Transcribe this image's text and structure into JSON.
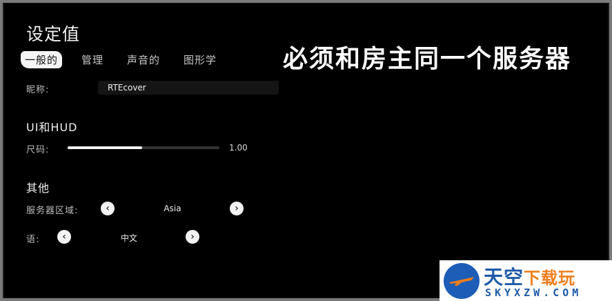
{
  "title": "设定值",
  "tabs": [
    {
      "label": "一般的",
      "active": true
    },
    {
      "label": "管理",
      "active": false
    },
    {
      "label": "声音的",
      "active": false
    },
    {
      "label": "图形学",
      "active": false
    }
  ],
  "general": {
    "nickname_label": "昵称:",
    "nickname_value": "RTEcover"
  },
  "ui_hud": {
    "section_title": "UI和HUD",
    "size_label": "尺码:",
    "size_value": "1.00",
    "size_fraction": 0.49
  },
  "other": {
    "section_title": "其他",
    "server_region_label": "服务器区域:",
    "server_region_value": "Asia",
    "language_label": "语:",
    "language_value": "中文"
  },
  "banner_text": "必须和房主同一个服务器",
  "watermark": {
    "main_blue": "天空",
    "main_orange": "下载玩",
    "sub": "SKYXZW.COM"
  },
  "colors": {
    "background": "#000000",
    "active_tab": "#f4f4f4",
    "logo_blue": "#1e5aa8",
    "logo_orange": "#ef7d1b"
  }
}
